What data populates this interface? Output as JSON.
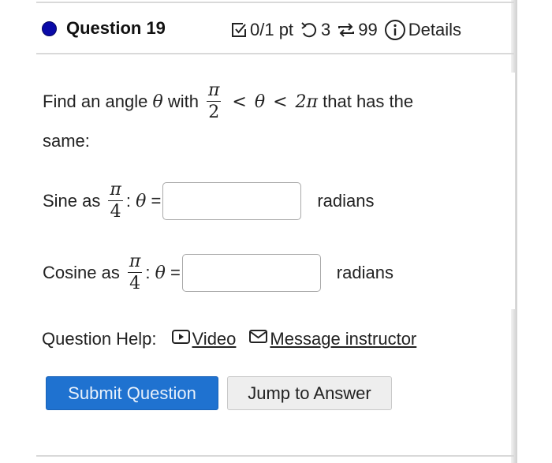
{
  "question": {
    "title": "Question 19",
    "status_dot_color": "#0a0aa8",
    "score": "0/1 pt",
    "attempts": "3",
    "retries": "99",
    "details_label": "Details",
    "icons": {
      "score": "checkbox-icon",
      "attempts": "undo-icon",
      "retries": "repeat-icon",
      "details": "info-icon"
    }
  },
  "problem": {
    "prefix": "Find an angle",
    "theta": "θ",
    "with": "with",
    "lower_num": "π",
    "lower_den": "2",
    "lt1": "<",
    "lt2": "<",
    "upper": "2π",
    "suffix": "that has the",
    "line2": "same:"
  },
  "parts": [
    {
      "label": "Sine as",
      "frac_num": "π",
      "frac_den": "4",
      "colon": ":",
      "theta": "θ",
      "equals": "=",
      "value": "",
      "units": "radians"
    },
    {
      "label": "Cosine as",
      "frac_num": "π",
      "frac_den": "4",
      "colon": ":",
      "theta": "θ",
      "equals": "=",
      "value": "",
      "units": "radians"
    }
  ],
  "help": {
    "label": "Question Help:",
    "video_label": "Video",
    "message_label": "Message instructor"
  },
  "buttons": {
    "submit_label": "Submit Question",
    "submit_color": "#1f72d0",
    "jump_label": "Jump to Answer"
  }
}
